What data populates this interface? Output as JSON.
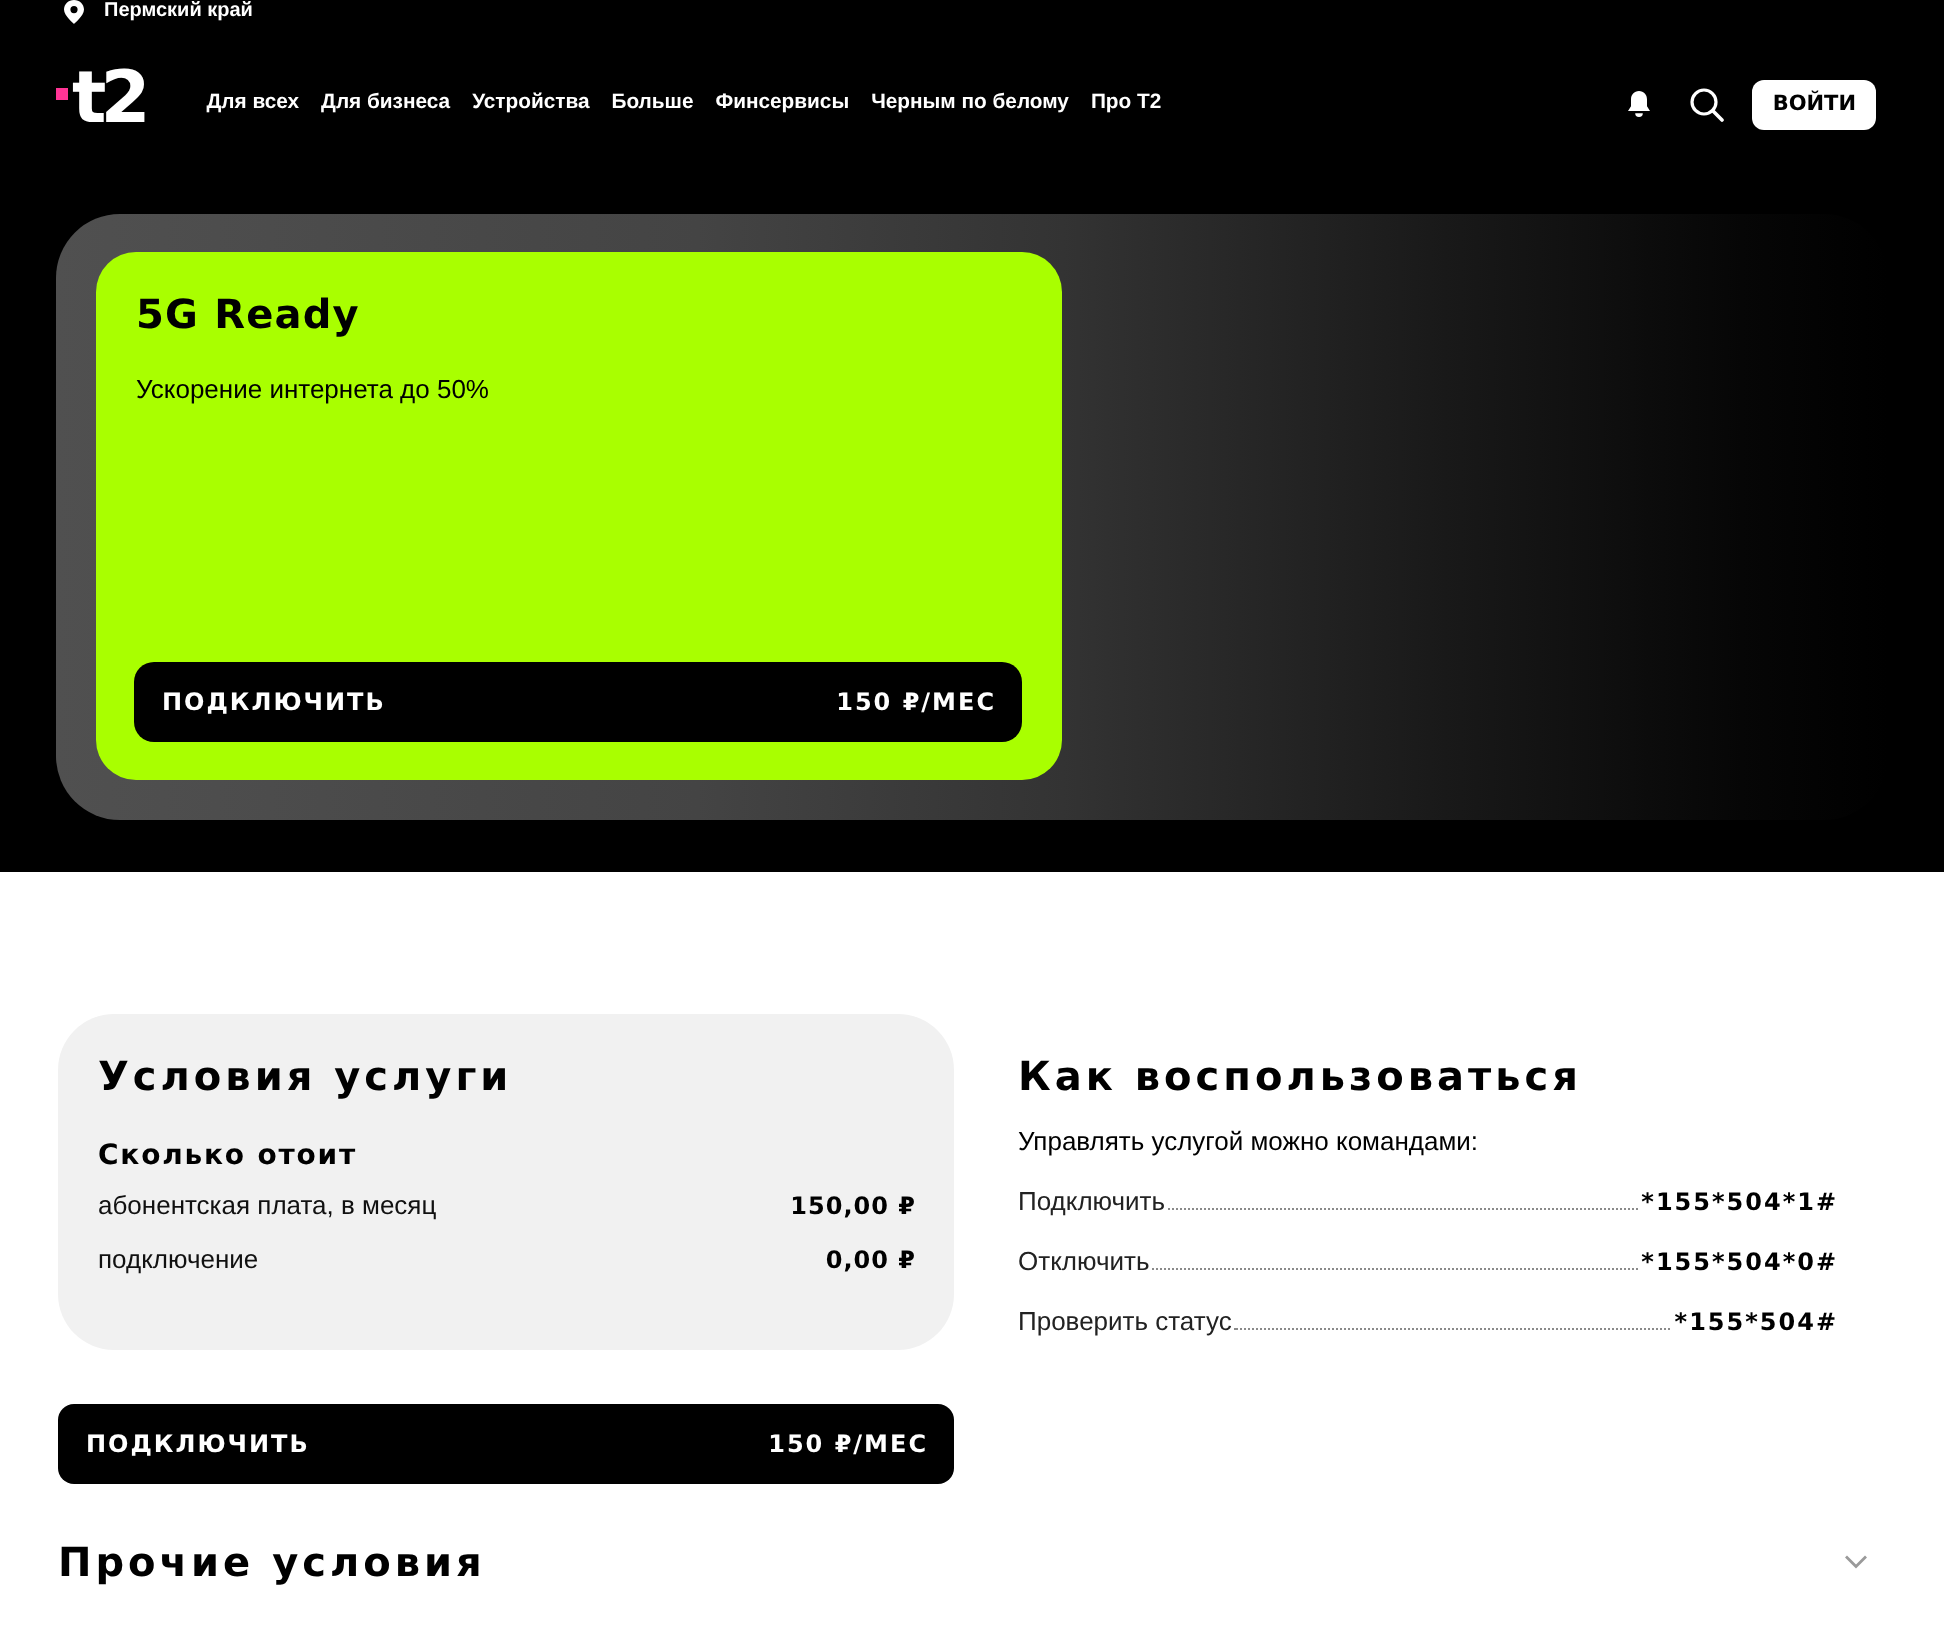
{
  "location": {
    "region": "Пермский край"
  },
  "header": {
    "logo": "t2",
    "nav": [
      {
        "label": "Для всех"
      },
      {
        "label": "Для бизнеса"
      },
      {
        "label": "Устройства"
      },
      {
        "label": "Больше"
      },
      {
        "label": "Финсервисы"
      },
      {
        "label": "Черным по белому"
      },
      {
        "label": "Про Т2"
      }
    ],
    "login_button": "ВОЙТИ"
  },
  "hero": {
    "title": "5G Ready",
    "subtitle": "Ускорение интернета до 50%",
    "button": {
      "label": "ПОДКЛЮЧИТЬ",
      "price": "150 ₽/МЕС"
    }
  },
  "conditions": {
    "title": "Условия услуги",
    "subtitle": "Сколько отоит",
    "rows": [
      {
        "label": "абонентская плата, в месяц",
        "value": "150,00 ₽"
      },
      {
        "label": "подключение",
        "value": "0,00 ₽"
      }
    ],
    "button": {
      "label": "ПОДКЛЮЧИТЬ",
      "price": "150 ₽/МЕС"
    }
  },
  "usage": {
    "title": "Как воспользоваться",
    "intro": "Управлять услугой можно командами:",
    "commands": [
      {
        "label": "Подключить",
        "code": "*155*504*1#"
      },
      {
        "label": "Отключить",
        "code": "*155*504*0#"
      },
      {
        "label": "Проверить статус",
        "code": "*155*504#"
      }
    ]
  },
  "other_conditions": {
    "title": "Прочие условия",
    "expanded": false
  }
}
